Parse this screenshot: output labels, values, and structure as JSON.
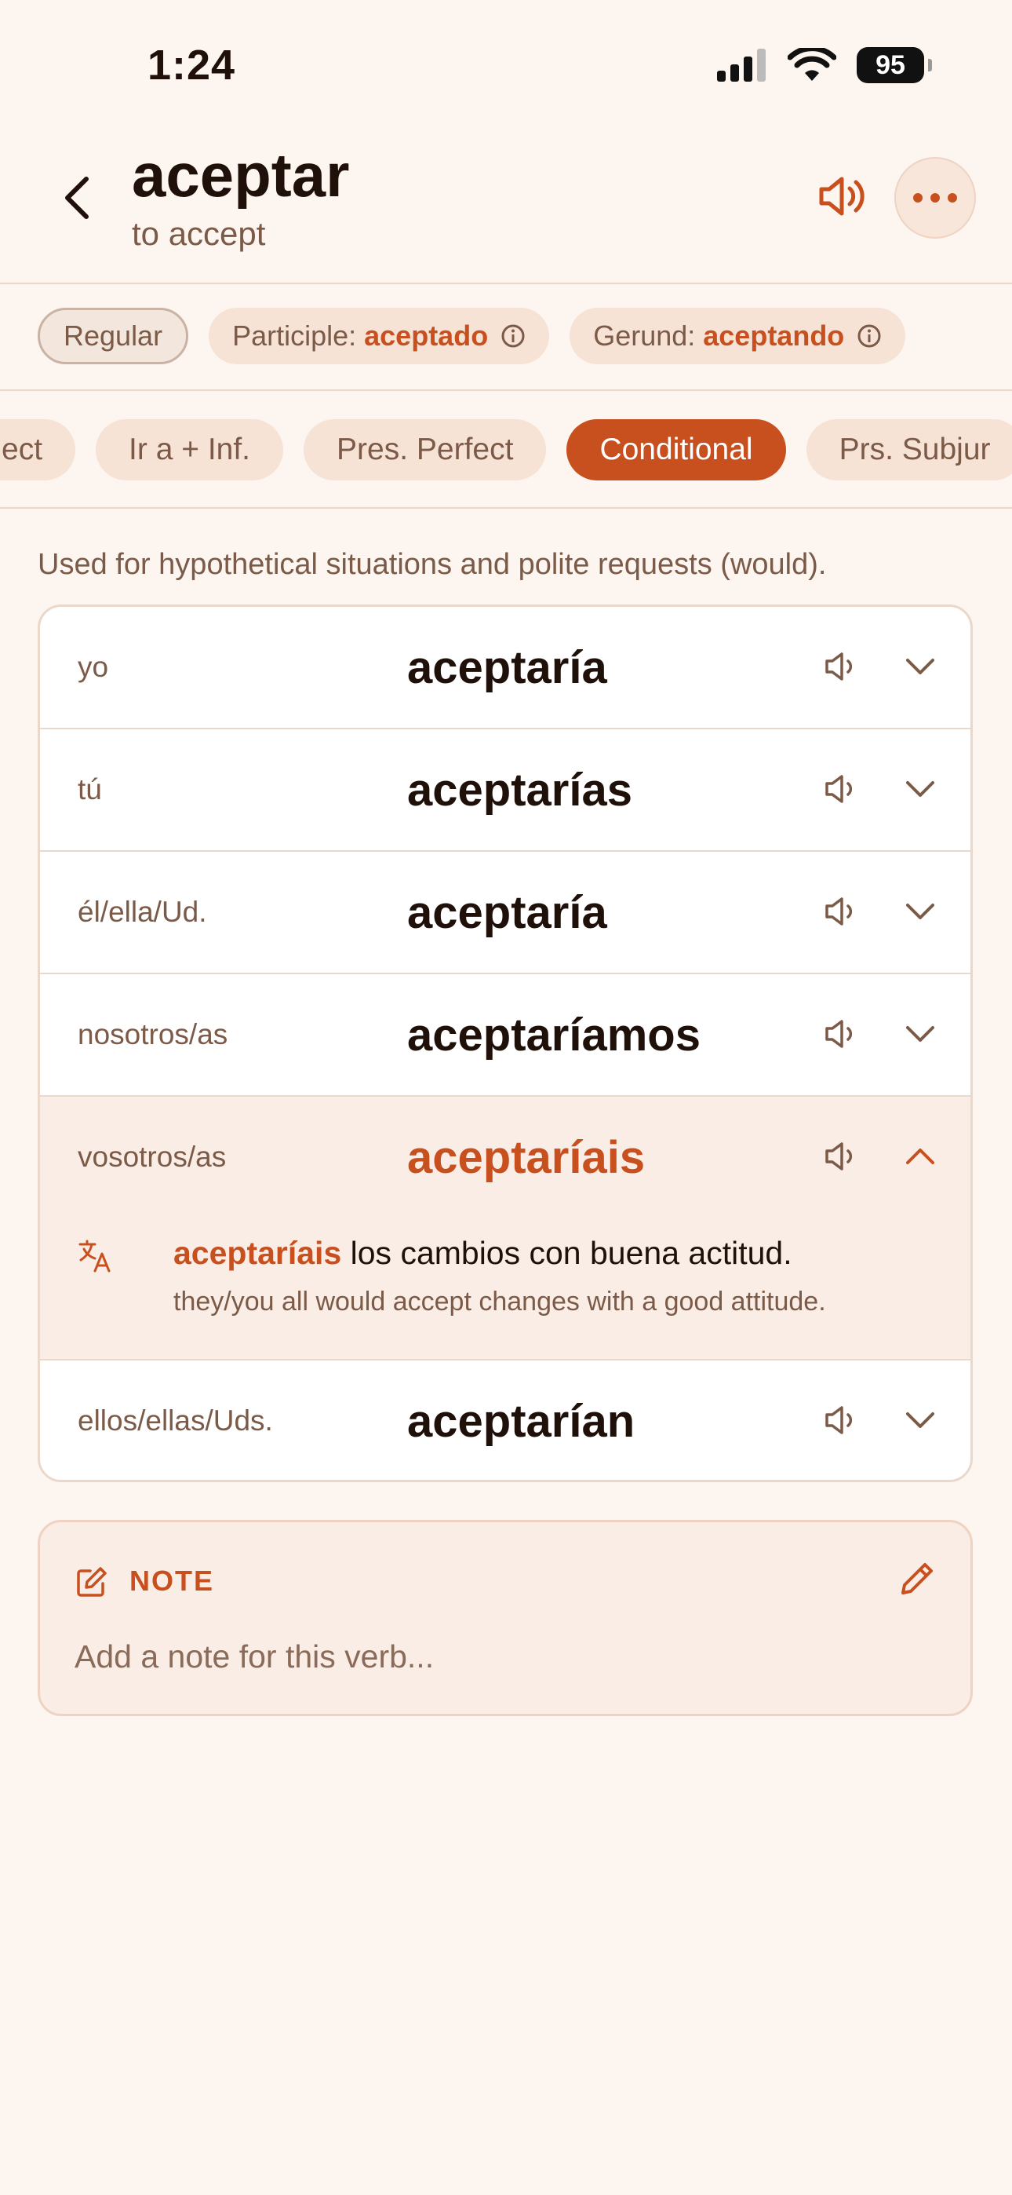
{
  "status_bar": {
    "time": "1:24",
    "battery": "95"
  },
  "header": {
    "title": "aceptar",
    "subtitle": "to accept"
  },
  "chips": {
    "regular": "Regular",
    "participle_label": "Participle:",
    "participle_value": "aceptado",
    "gerund_label": "Gerund:",
    "gerund_value": "aceptando"
  },
  "tabs": [
    {
      "label": "ect"
    },
    {
      "label": "Ir a + Inf."
    },
    {
      "label": "Pres. Perfect"
    },
    {
      "label": "Conditional",
      "active": true
    },
    {
      "label": "Prs. Subjur"
    }
  ],
  "description": "Used for hypothetical situations and polite requests (would).",
  "conjugations": [
    {
      "pronoun": "yo",
      "form": "aceptaría"
    },
    {
      "pronoun": "tú",
      "form": "aceptarías"
    },
    {
      "pronoun": "él/ella/Ud.",
      "form": "aceptaría"
    },
    {
      "pronoun": "nosotros/as",
      "form": "aceptaríamos"
    },
    {
      "pronoun": "vosotros/as",
      "form": "aceptaríais",
      "expanded": true,
      "example_highlight": "aceptaríais",
      "example_rest": " los cambios con buena actitud.",
      "example_translation": "they/you all would accept changes with a good attitude."
    },
    {
      "pronoun": "ellos/ellas/Uds.",
      "form": "aceptarían"
    }
  ],
  "note": {
    "label": "NOTE",
    "placeholder": "Add a note for this verb..."
  },
  "colors": {
    "accent": "#C8501E",
    "background": "#FDF5EF",
    "muted_text": "#7B5A48"
  },
  "icons": [
    "back-chevron-icon",
    "speaker-icon",
    "more-dots-icon",
    "info-icon",
    "chevron-down-icon",
    "chevron-up-icon",
    "translate-icon",
    "note-edit-icon",
    "pencil-icon"
  ]
}
